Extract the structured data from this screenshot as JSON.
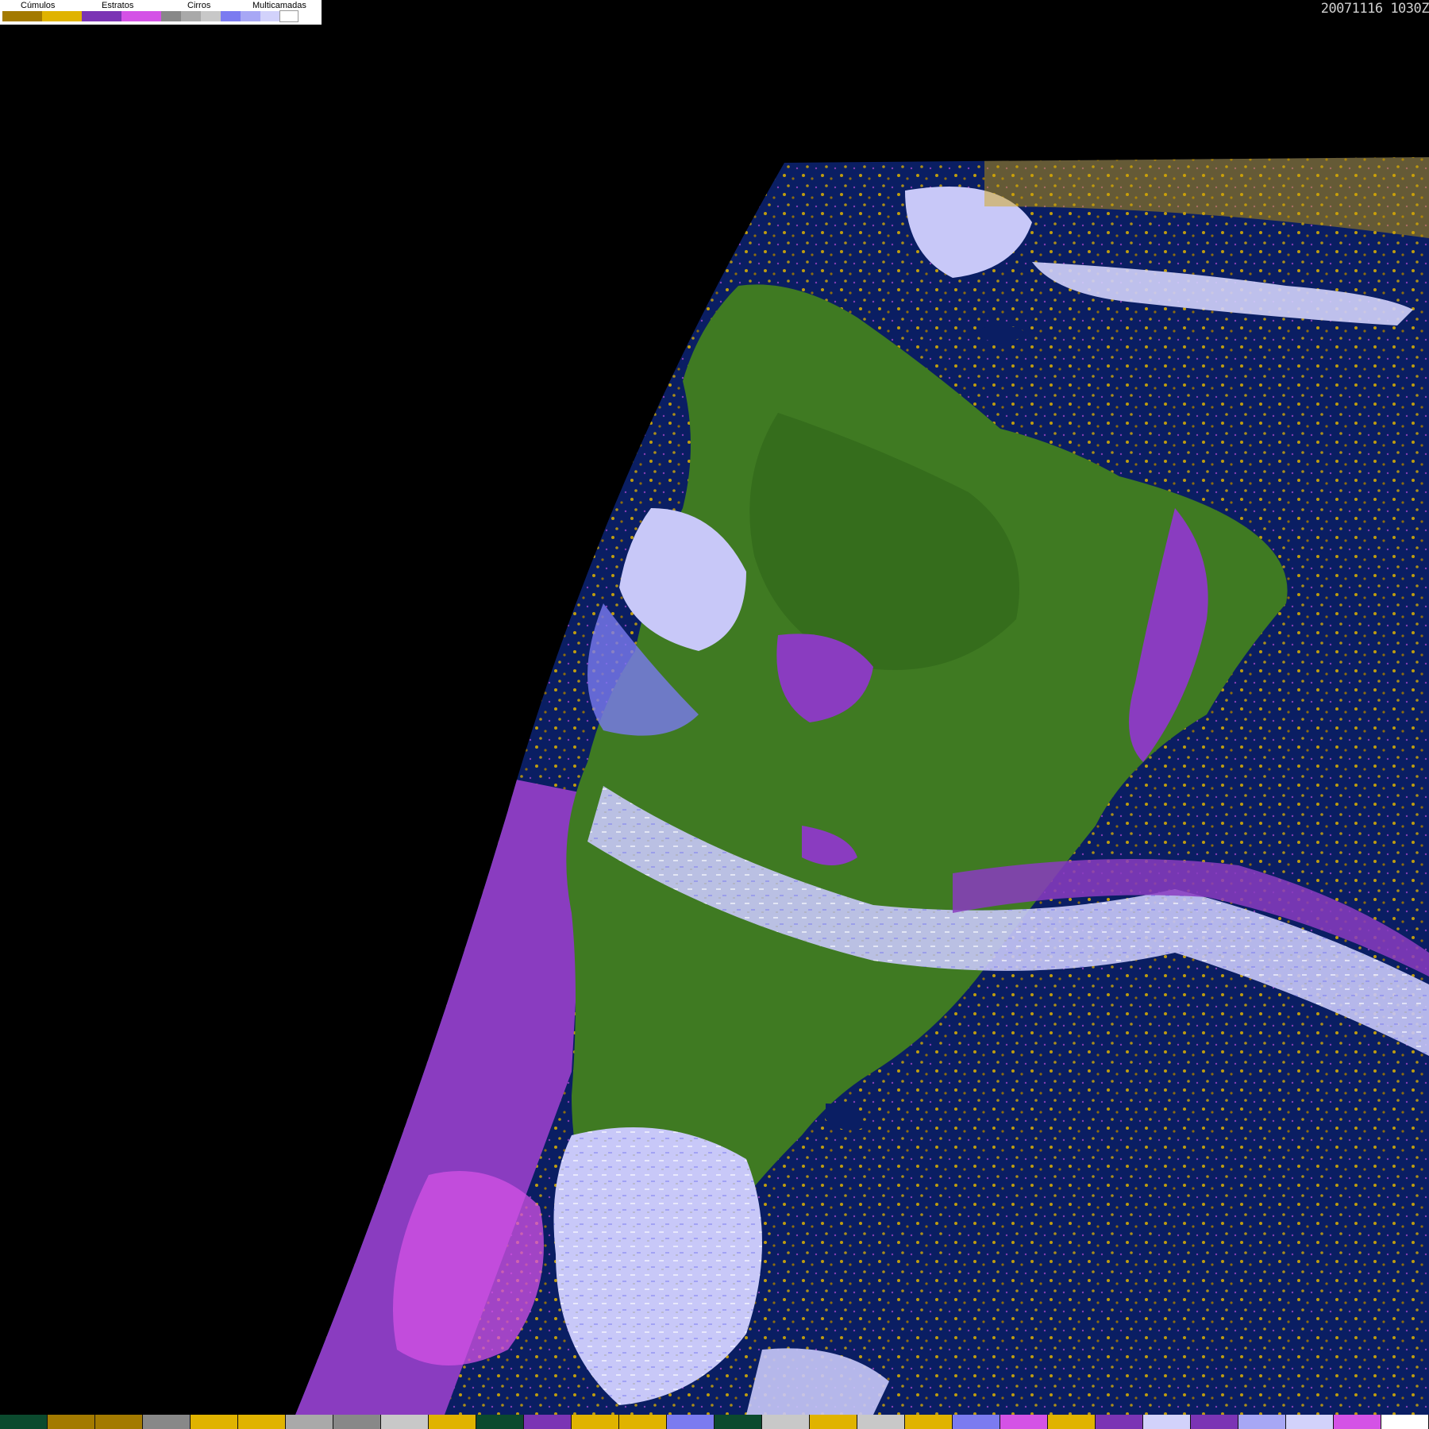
{
  "timestamp": "20071116 1030Z",
  "legend": {
    "groups": [
      {
        "label": "Cúmulos",
        "colors": [
          "#a37a00",
          "#e0b300"
        ]
      },
      {
        "label": "Estratos",
        "colors": [
          "#7b34b4",
          "#d452e6"
        ]
      },
      {
        "label": "Cirros",
        "colors": [
          "#888888",
          "#a9a9a9",
          "#c8c8c8"
        ]
      },
      {
        "label": "Multicamadas",
        "colors": [
          "#7b7bf0",
          "#a7a7f5",
          "#d2d2fb",
          "#ffffff"
        ]
      }
    ]
  },
  "colors": {
    "background": "#000000",
    "ocean": "#0a1e63",
    "land": "#3f7a22",
    "land_dark": "#2e6419",
    "stratus": "#8a3cc0",
    "cumulus": "#d4a300",
    "multilayer": "#c8c8f8"
  },
  "bottom_bar": [
    "#0b4a2e",
    "#a37a00",
    "#a37a00",
    "#888888",
    "#e0b300",
    "#e0b300",
    "#a9a9a9",
    "#888888",
    "#c8c8c8",
    "#e0b300",
    "#0b4a2e",
    "#7b34b4",
    "#e0b300",
    "#e0b300",
    "#7b7bf0",
    "#0b4a2e",
    "#c8c8c8",
    "#e0b300",
    "#c8c8c8",
    "#e0b300",
    "#7b7bf0",
    "#d452e6",
    "#e0b300",
    "#7b34b4",
    "#d2d2fb",
    "#7b34b4",
    "#a7a7f5",
    "#d2d2fb",
    "#d452e6",
    "#ffffff"
  ]
}
